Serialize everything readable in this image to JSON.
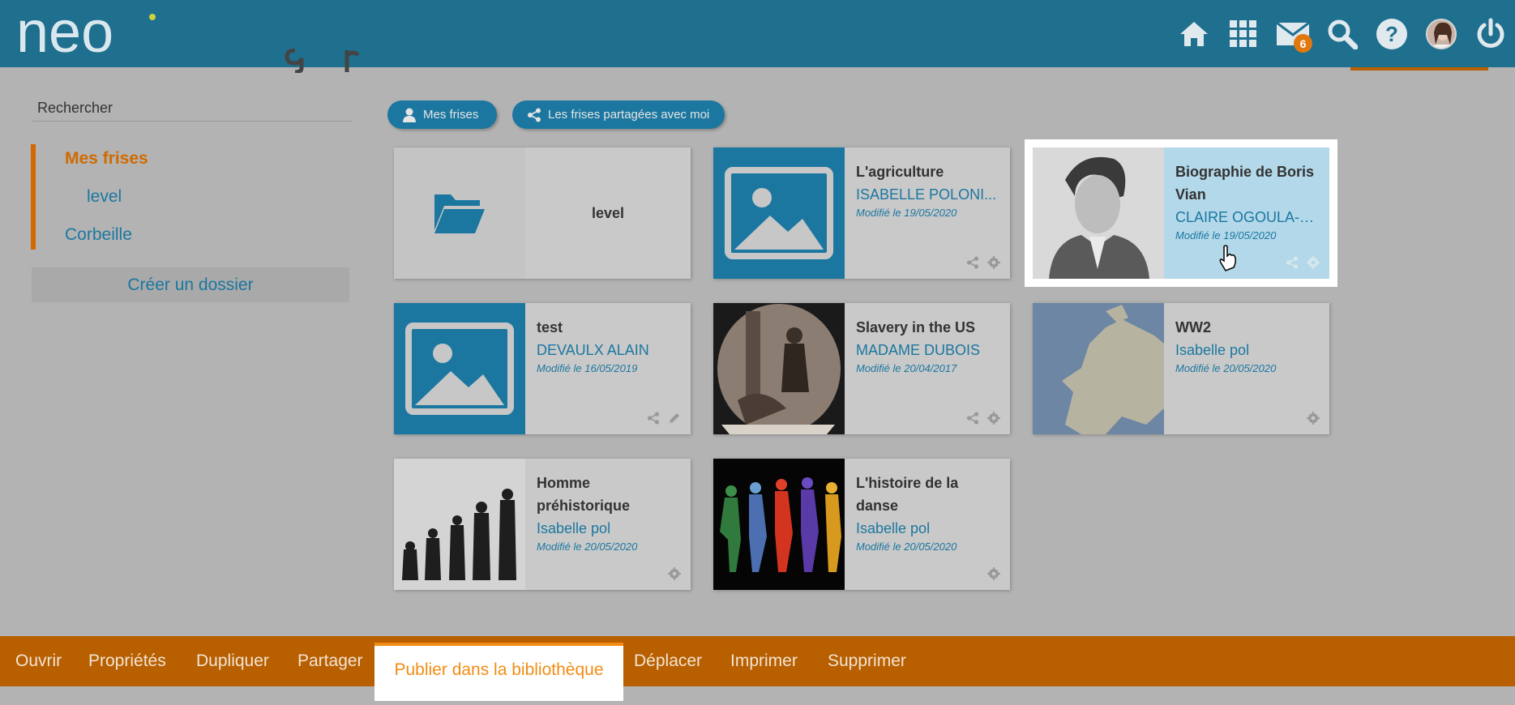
{
  "header": {
    "logo_text": "neo",
    "mail_badge": "6"
  },
  "sidebar": {
    "search_placeholder": "Rechercher",
    "tree": {
      "root": "Mes frises",
      "child": "level",
      "trash": "Corbeille"
    },
    "create_folder": "Créer un dossier"
  },
  "filters": {
    "mine": "Mes frises",
    "shared": "Les frises partagées avec moi"
  },
  "cards": [
    {
      "title": "level"
    },
    {
      "title": "L'agriculture",
      "owner": "ISABELLE POLONI...",
      "date": "Modifié le 19/05/2020"
    },
    {
      "title": "Biographie de Boris Vian",
      "owner": "CLAIRE OGOULA-N...",
      "date": "Modifié le 19/05/2020"
    },
    {
      "title": "test",
      "owner": "DEVAULX ALAIN",
      "date": "Modifié le 16/05/2019"
    },
    {
      "title": "Slavery in the US",
      "owner": "MADAME DUBOIS",
      "date": "Modifié le 20/04/2017"
    },
    {
      "title": "WW2",
      "owner": "Isabelle pol",
      "date": "Modifié le 20/05/2020"
    },
    {
      "title": "Homme préhistorique",
      "owner": "Isabelle pol",
      "date": "Modifié le 20/05/2020"
    },
    {
      "title": "L'histoire de la danse",
      "owner": "Isabelle pol",
      "date": "Modifié le 20/05/2020"
    }
  ],
  "toolbar": {
    "open": "Ouvrir",
    "properties": "Propriétés",
    "duplicate": "Dupliquer",
    "share": "Partager",
    "publish": "Publier dans la bibliothèque",
    "move": "Déplacer",
    "print": "Imprimer",
    "delete": "Supprimer"
  },
  "colors": {
    "header": "#1f6f8f",
    "accent": "#b85f00",
    "link": "#1b77a0",
    "publish_highlight": "#f28c13"
  }
}
